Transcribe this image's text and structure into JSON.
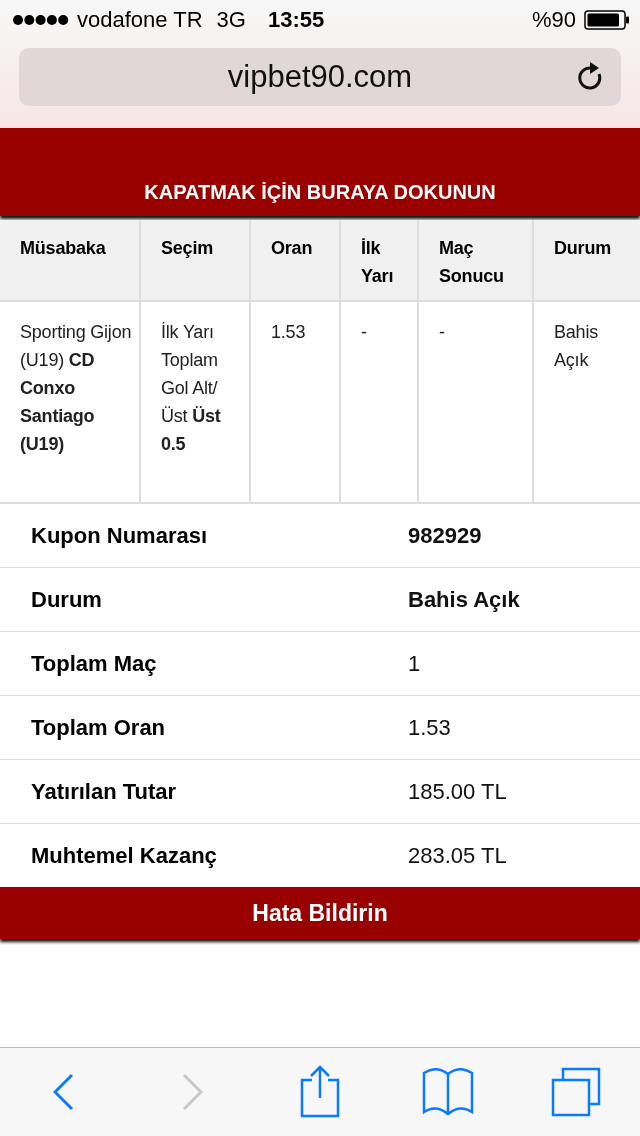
{
  "status_bar": {
    "carrier": "vodafone TR",
    "network": "3G",
    "time": "13:55",
    "battery_text": "%90"
  },
  "address_bar": {
    "url": "vipbet90.com"
  },
  "banner": {
    "label": "KAPATMAK İÇİN BURAYA DOKUNUN"
  },
  "table": {
    "columns": [
      "Müsabaka",
      "Seçim",
      "Oran",
      "İlk Yarı",
      "Maç Sonucu",
      "Durum"
    ],
    "rows": [
      [
        "Sporting Gijon (U19) **CD Conxo Santiago (U19)**",
        "İlk Yarı Toplam Gol Alt/Üst **Üst 0.5**",
        "1.53",
        "-",
        "-",
        "Bahis Açık"
      ]
    ]
  },
  "summary": [
    {
      "label": "Kupon Numarası",
      "value": "982929",
      "emphasis": true
    },
    {
      "label": "Durum",
      "value": "Bahis Açık",
      "emphasis": true
    },
    {
      "label": "Toplam Maç",
      "value": "1",
      "emphasis": false
    },
    {
      "label": "Toplam Oran",
      "value": "1.53",
      "emphasis": false
    },
    {
      "label": "Yatırılan Tutar",
      "value": "185.00 TL",
      "emphasis": false
    },
    {
      "label": "Muhtemel Kazanç",
      "value": "283.05 TL",
      "emphasis": false
    }
  ],
  "report_button": {
    "label": "Hata Bildirin"
  },
  "toolbar": [
    {
      "kind": "back",
      "disabled": false
    },
    {
      "kind": "forward",
      "disabled": true
    },
    {
      "kind": "share",
      "disabled": false
    },
    {
      "kind": "bookmarks",
      "disabled": false
    },
    {
      "kind": "tabs",
      "disabled": false
    }
  ]
}
